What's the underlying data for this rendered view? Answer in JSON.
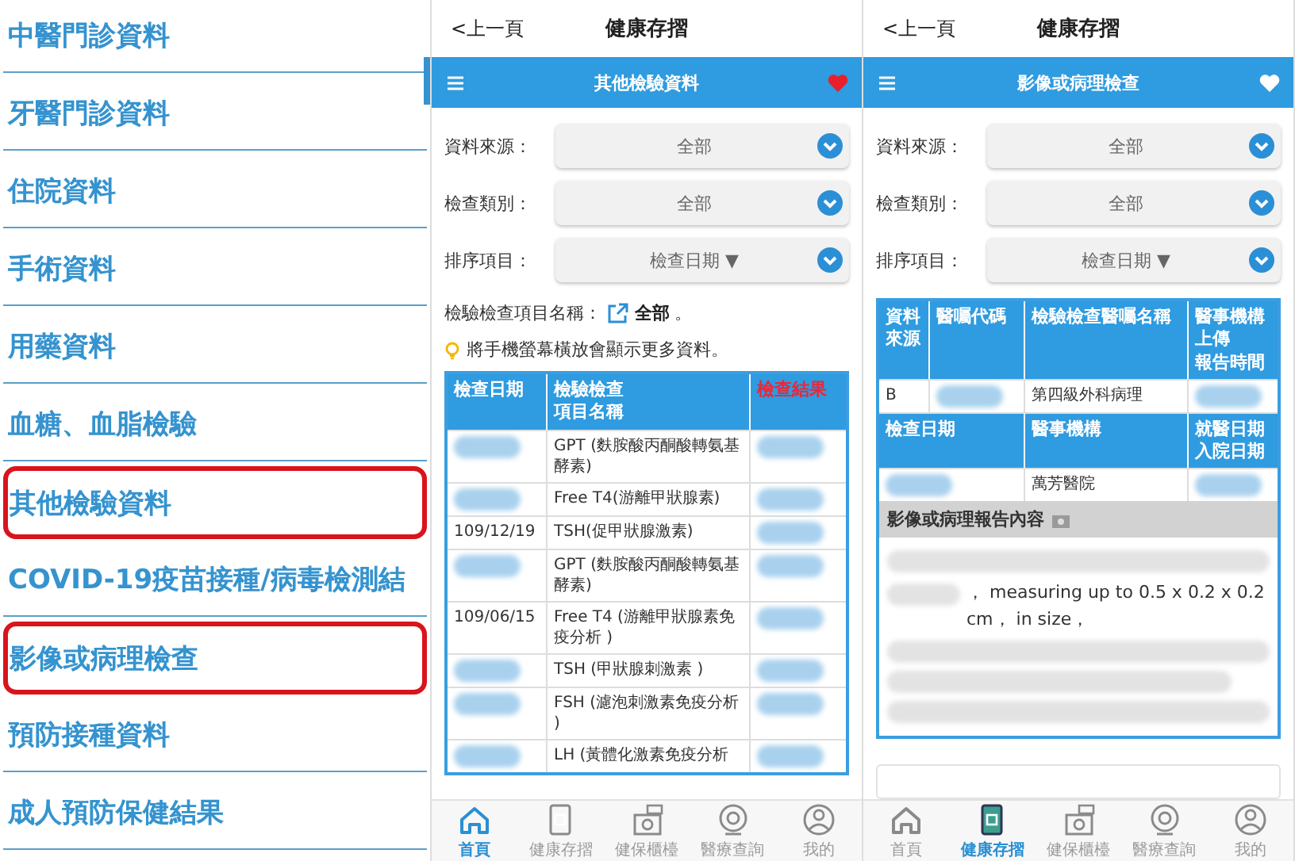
{
  "menu": {
    "items": [
      {
        "label": "中醫門診資料",
        "highlighted": false
      },
      {
        "label": "牙醫門診資料",
        "highlighted": false
      },
      {
        "label": "住院資料",
        "highlighted": false
      },
      {
        "label": "手術資料",
        "highlighted": false
      },
      {
        "label": "用藥資料",
        "highlighted": false
      },
      {
        "label": "血糖、血脂檢驗",
        "highlighted": false
      },
      {
        "label": "其他檢驗資料",
        "highlighted": true
      },
      {
        "label": "COVID-19疫苗接種/病毒檢測結",
        "highlighted": false
      },
      {
        "label": "影像或病理檢查",
        "highlighted": true
      },
      {
        "label": "預防接種資料",
        "highlighted": false
      },
      {
        "label": "成人預防保健結果",
        "highlighted": false
      }
    ]
  },
  "screens": [
    {
      "back": "<上一頁",
      "app_title": "健康存摺",
      "page_title": "其他檢驗資料",
      "favorited": true,
      "filters": [
        {
          "label": "資料來源：",
          "value": "全部"
        },
        {
          "label": "檢查類別：",
          "value": "全部"
        },
        {
          "label": "排序項目：",
          "value": "檢查日期 ▼"
        }
      ],
      "item_filter": {
        "label": "檢驗檢查項目名稱：",
        "link": "全部",
        "suffix": "。"
      },
      "hint": "將手機螢幕橫放會顯示更多資料。",
      "results_table": {
        "columns": [
          {
            "lines": [
              "檢查日期"
            ],
            "highlighted": false
          },
          {
            "lines": [
              "檢驗檢查",
              "項目名稱"
            ],
            "highlighted": false
          },
          {
            "lines": [
              "檢查結果"
            ],
            "highlighted": true
          }
        ],
        "rows": [
          [
            {
              "kind": "redacted"
            },
            {
              "kind": "text",
              "text": "GPT (麩胺酸丙酮酸轉氨基酵素)"
            },
            {
              "kind": "redacted"
            }
          ],
          [
            {
              "kind": "redacted"
            },
            {
              "kind": "text",
              "text": "Free T4(游離甲狀腺素)"
            },
            {
              "kind": "redacted"
            }
          ],
          [
            {
              "kind": "text",
              "text": "109/12/19"
            },
            {
              "kind": "text",
              "text": "TSH(促甲狀腺激素)"
            },
            {
              "kind": "redacted"
            }
          ],
          [
            {
              "kind": "redacted"
            },
            {
              "kind": "text",
              "text": "GPT (麩胺酸丙酮酸轉氨基酵素)"
            },
            {
              "kind": "redacted"
            }
          ],
          [
            {
              "kind": "text",
              "text": "109/06/15"
            },
            {
              "kind": "text",
              "text": "Free T4 (游離甲狀腺素免疫分析 )"
            },
            {
              "kind": "redacted"
            }
          ],
          [
            {
              "kind": "redacted"
            },
            {
              "kind": "text",
              "text": "TSH (甲狀腺刺激素 )"
            },
            {
              "kind": "redacted"
            }
          ],
          [
            {
              "kind": "redacted"
            },
            {
              "kind": "text",
              "text": "FSH (濾泡刺激素免疫分析 )"
            },
            {
              "kind": "redacted"
            }
          ],
          [
            {
              "kind": "redacted"
            },
            {
              "kind": "text",
              "text": "LH (黃體化激素免疫分析"
            },
            {
              "kind": "redacted"
            }
          ]
        ]
      },
      "nav": [
        {
          "label": "首頁",
          "selected": true
        },
        {
          "label": "健康存摺",
          "selected": false
        },
        {
          "label": "健保櫃檯",
          "selected": false
        },
        {
          "label": "醫療查詢",
          "selected": false
        },
        {
          "label": "我的",
          "selected": false
        }
      ]
    },
    {
      "back": "<上一頁",
      "app_title": "健康存摺",
      "page_title": "影像或病理檢查",
      "favorited": false,
      "filters": [
        {
          "label": "資料來源：",
          "value": "全部"
        },
        {
          "label": "檢查類別：",
          "value": "全部"
        },
        {
          "label": "排序項目：",
          "value": "檢查日期 ▼"
        }
      ],
      "record_table": {
        "groups": [
          {
            "columns": [
              {
                "lines": [
                  "資料來源"
                ]
              },
              {
                "lines": [
                  "醫囑代碼"
                ]
              },
              {
                "lines": [
                  "檢驗檢查醫囑名稱"
                ]
              },
              {
                "lines": [
                  "醫事機構",
                  "上傳",
                  "報告時間"
                ]
              }
            ],
            "cells": [
              {
                "kind": "text",
                "text": "B"
              },
              {
                "kind": "redacted"
              },
              {
                "kind": "text",
                "text": "第四級外科病理"
              },
              {
                "kind": "redacted"
              }
            ]
          },
          {
            "columns": [
              {
                "lines": [
                  "檢查日期"
                ]
              },
              {
                "lines": [
                  "醫事機構"
                ]
              },
              {
                "lines": [
                  "就醫日期",
                  "入院日期"
                ]
              }
            ],
            "cells": [
              {
                "kind": "redacted"
              },
              {
                "kind": "text",
                "text": "萬芳醫院"
              },
              {
                "kind": "redacted"
              }
            ]
          }
        ],
        "report": {
          "title": "影像或病理報告內容",
          "text": "， measuring up to 0.5 x 0.2 x 0.2 cm， in size，"
        }
      },
      "nav": [
        {
          "label": "首頁",
          "selected": false
        },
        {
          "label": "健康存摺",
          "selected": true
        },
        {
          "label": "健保櫃檯",
          "selected": false
        },
        {
          "label": "醫療查詢",
          "selected": false
        },
        {
          "label": "我的",
          "selected": false
        }
      ]
    }
  ]
}
